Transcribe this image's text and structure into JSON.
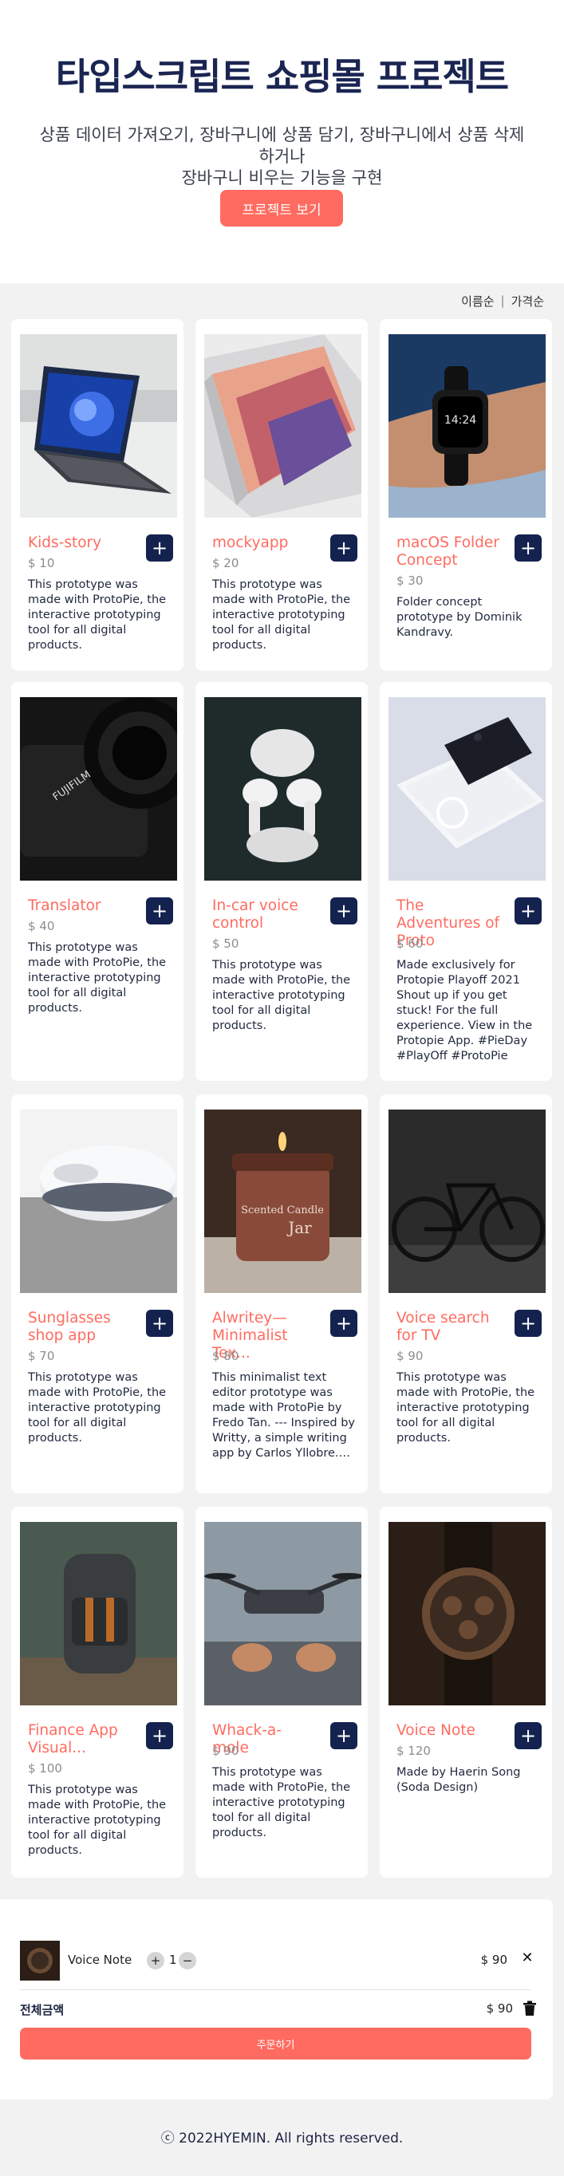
{
  "hero": {
    "title": "타입스크립트 쇼핑몰 프로젝트",
    "subtitle_line1": "상품 데이터 가져오기, 장바구니에 상품 담기, 장바구니에서 상품 삭제하거나",
    "subtitle_line2": "장바구니 비우는 기능을 구현",
    "button_label": "프로젝트 보기"
  },
  "sort": {
    "by_name": "이름순",
    "separator": "|",
    "by_price": "가격순"
  },
  "add_label": "+",
  "products": [
    {
      "title": "Kids-story",
      "price": "$ 10",
      "desc": "This prototype was made with ProtoPie, the interactive prototyping tool for all digital products.",
      "image": "laptop-tablet"
    },
    {
      "title": "mockyapp",
      "price": "$ 20",
      "desc": "This prototype was made with ProtoPie, the interactive prototyping tool for all digital products.",
      "image": "laptop-lid"
    },
    {
      "title": "macOS Folder Concept",
      "price": "$ 30",
      "desc": "Folder concept prototype by Dominik Kandravy.",
      "image": "smartwatch"
    },
    {
      "title": "Translator",
      "price": "$ 40",
      "desc": "This prototype was made with ProtoPie, the interactive prototyping tool for all digital products.",
      "image": "camera"
    },
    {
      "title": "In-car voice control",
      "price": "$ 50",
      "desc": "This prototype was made with ProtoPie, the interactive prototyping tool for all digital products.",
      "image": "earbuds"
    },
    {
      "title": "The Adventures of Proto",
      "price": "$ 60",
      "desc": "Made exclusively for Protopie Playoff 2021 Shout up if you get stuck! For the full experience. View in the Protopie App. #PieDay #PlayOff #ProtoPie",
      "image": "phone-box"
    },
    {
      "title": "Sunglasses shop app",
      "price": "$ 70",
      "desc": "This prototype was made with ProtoPie, the interactive prototyping tool for all digital products.",
      "image": "robot-vacuum"
    },
    {
      "title": "Alwritey—Minimalist Tex...",
      "price": "$ 80",
      "desc": "This minimalist text editor prototype was made with ProtoPie by Fredo Tan. --- Inspired by Writty, a simple writing app by Carlos Yllobre. Try out Writty ...",
      "image": "candle"
    },
    {
      "title": "Voice search for TV",
      "price": "$ 90",
      "desc": "This prototype was made with ProtoPie, the interactive prototyping tool for all digital products.",
      "image": "bicycle"
    },
    {
      "title": "Finance App Visual...",
      "price": "$ 100",
      "desc": "This prototype was made with ProtoPie, the interactive prototyping tool for all digital products.",
      "image": "backpack"
    },
    {
      "title": "Whack-a-mole",
      "price": "$ 90",
      "desc": "This prototype was made with ProtoPie, the interactive prototyping tool for all digital products.",
      "image": "drone"
    },
    {
      "title": "Voice Note",
      "price": "$ 120",
      "desc": "Made by Haerin Song (Soda Design)",
      "image": "wristwatch"
    }
  ],
  "cart": {
    "item_name": "Voice Note",
    "decrease_label": "+",
    "quantity": "1",
    "increase_label": "−",
    "item_price": "$ 90",
    "remove_label": "✕",
    "total_label": "전체금액",
    "total_price": "$ 90",
    "order_label": "주문하기"
  },
  "footer": {
    "copyright": "ⓒ 2022HYEMIN. All rights reserved."
  },
  "colors": {
    "accent": "#ff6b60",
    "navy": "#14224f",
    "background": "#f2f2f3"
  }
}
